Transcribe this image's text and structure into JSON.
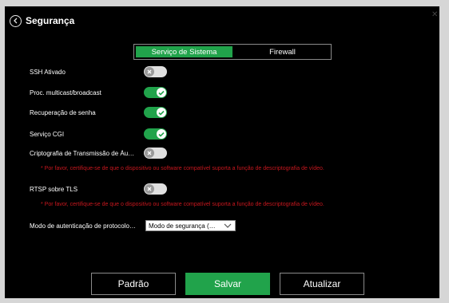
{
  "header": {
    "title": "Segurança"
  },
  "tabs": [
    {
      "label": "Serviço de Sistema",
      "active": true
    },
    {
      "label": "Firewall",
      "active": false
    }
  ],
  "settings": [
    {
      "label": "SSH Ativado",
      "enabled": false
    },
    {
      "label": "Proc. multicast/broadcast",
      "enabled": true
    },
    {
      "label": "Recuperação de senha",
      "enabled": true
    },
    {
      "label": "Serviço CGI",
      "enabled": true
    },
    {
      "label": "Criptografia de Transmissão de Áu…",
      "enabled": false
    },
    {
      "label": "RTSP sobre TLS",
      "enabled": false
    }
  ],
  "warnings": {
    "audio": "* Por favor, certifique-se de que o dispositivo ou software compatível suporta a função de descriptografia de vídeo.",
    "rtsp": "* Por favor, certifique-se de que o dispositivo ou software compatível suporta a função de descriptografia de vídeo."
  },
  "auth": {
    "label": "Modo de autenticação de protocolo…",
    "value": "Modo de segurança (…"
  },
  "buttons": {
    "default": "Padrão",
    "save": "Salvar",
    "refresh": "Atualizar"
  },
  "colors": {
    "accent": "#21a34b",
    "warning": "#c8171e",
    "background": "#000000"
  },
  "icons": {
    "back": "chevron-left-circle-icon",
    "on": "check-icon",
    "off": "x-icon",
    "select": "chevron-down-icon"
  }
}
